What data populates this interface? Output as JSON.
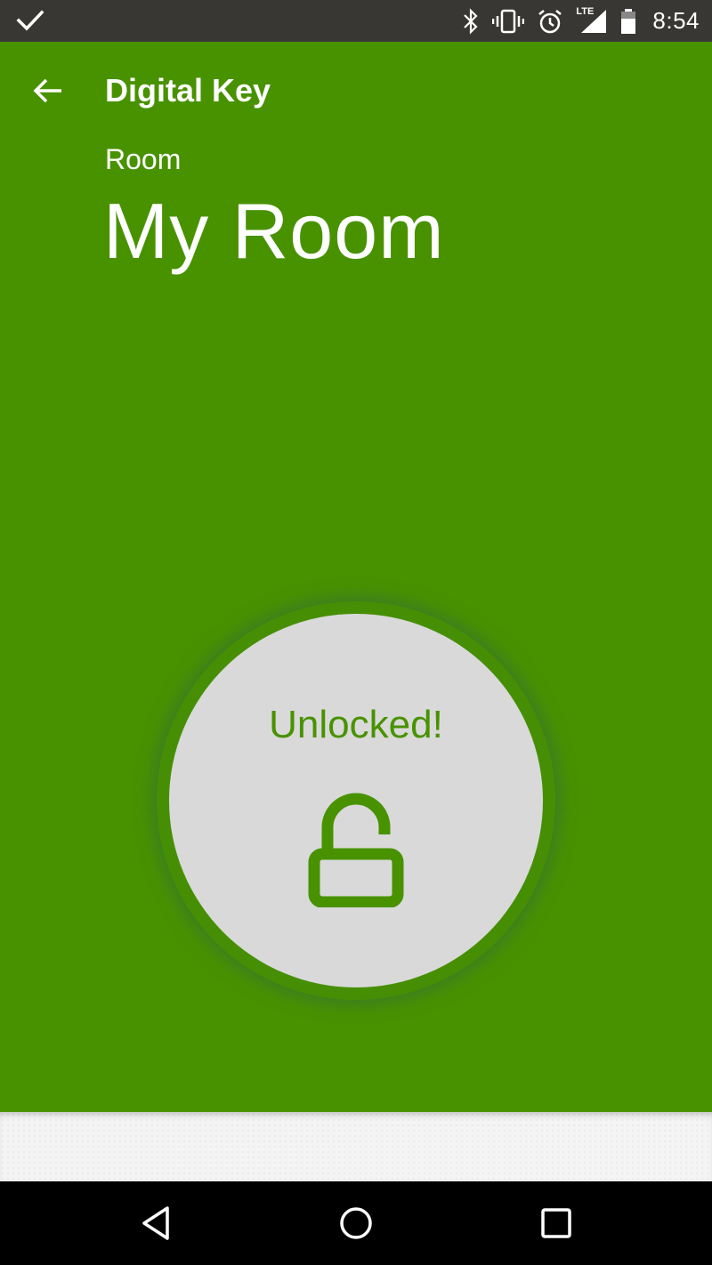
{
  "status_bar": {
    "time": "8:54",
    "network": "LTE",
    "icons": [
      "check-icon",
      "bluetooth-icon",
      "vibrate-icon",
      "alarm-icon",
      "signal-icon",
      "battery-icon"
    ]
  },
  "app_bar": {
    "title": "Digital Key",
    "back_icon": "arrow-left-icon"
  },
  "room": {
    "label": "Room",
    "name": "My Room"
  },
  "lock": {
    "status_text": "Unlocked!",
    "icon": "lock-open-icon"
  },
  "nav_bar": {
    "buttons": [
      "back-triangle-icon",
      "home-circle-icon",
      "recents-square-icon"
    ]
  },
  "colors": {
    "primary_green": "#489200",
    "status_bar": "#393733",
    "circle_fill": "#d9d9d9",
    "text_light": "#ffffff"
  }
}
